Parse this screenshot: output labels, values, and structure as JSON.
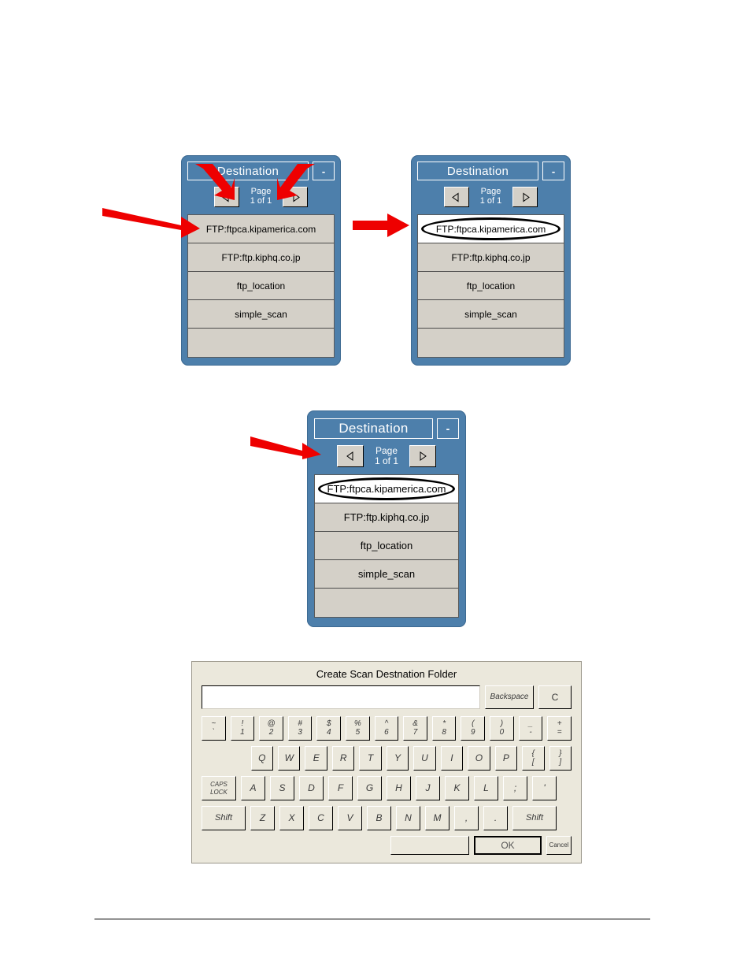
{
  "dialogs": {
    "title": "Destination",
    "minimize_label": "-",
    "page_label_line1": "Page",
    "page_label_line2": "1 of 1",
    "prev_icon": "triangle-left-icon",
    "next_icon": "triangle-right-icon",
    "items": [
      "FTP:ftpca.kipamerica.com",
      "FTP:ftp.kiphq.co.jp",
      "ftp_location",
      "simple_scan",
      ""
    ]
  },
  "keyboard": {
    "title": "Create Scan Destnation Folder",
    "input_value": "",
    "backspace_label": "Backspace",
    "clear_label": "C",
    "caps_lock_line1": "CAPS",
    "caps_lock_line2": "LOCK",
    "shift_label": "Shift",
    "space_label": "",
    "ok_label": "OK",
    "cancel_label": "Cancel",
    "number_row": [
      {
        "upper": "~",
        "lower": "`"
      },
      {
        "upper": "!",
        "lower": "1"
      },
      {
        "upper": "@",
        "lower": "2"
      },
      {
        "upper": "#",
        "lower": "3"
      },
      {
        "upper": "$",
        "lower": "4"
      },
      {
        "upper": "%",
        "lower": "5"
      },
      {
        "upper": "^",
        "lower": "6"
      },
      {
        "upper": "&",
        "lower": "7"
      },
      {
        "upper": "*",
        "lower": "8"
      },
      {
        "upper": "(",
        "lower": "9"
      },
      {
        "upper": ")",
        "lower": "0"
      },
      {
        "upper": "_",
        "lower": "-"
      },
      {
        "upper": "+",
        "lower": "="
      }
    ],
    "qwerty_row": [
      {
        "label": "Q"
      },
      {
        "label": "W"
      },
      {
        "label": "E"
      },
      {
        "label": "R"
      },
      {
        "label": "T"
      },
      {
        "label": "Y"
      },
      {
        "label": "U"
      },
      {
        "label": "I"
      },
      {
        "label": "O"
      },
      {
        "label": "P"
      },
      {
        "upper": "{",
        "lower": "["
      },
      {
        "upper": "}",
        "lower": "]"
      }
    ],
    "home_row": [
      {
        "label": "A"
      },
      {
        "label": "S"
      },
      {
        "label": "D"
      },
      {
        "label": "F"
      },
      {
        "label": "G"
      },
      {
        "label": "H"
      },
      {
        "label": "J"
      },
      {
        "label": "K"
      },
      {
        "label": "L"
      },
      {
        "label": ";"
      },
      {
        "label": "'"
      }
    ],
    "bottom_row": [
      {
        "label": "Z"
      },
      {
        "label": "X"
      },
      {
        "label": "C"
      },
      {
        "label": "V"
      },
      {
        "label": "B"
      },
      {
        "label": "N"
      },
      {
        "label": "M"
      },
      {
        "label": ","
      },
      {
        "label": "."
      }
    ]
  },
  "annotations": {
    "arrow_color": "#ee0000",
    "highlight_color": "#000000"
  }
}
